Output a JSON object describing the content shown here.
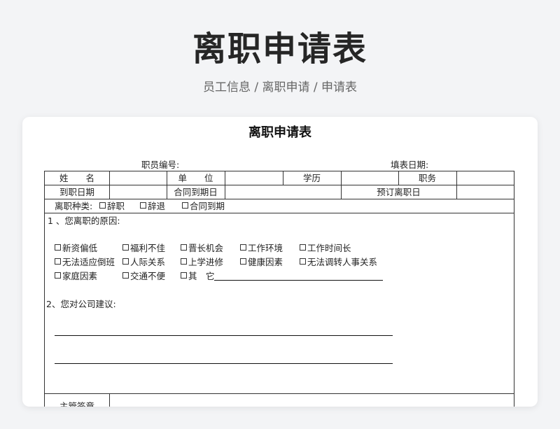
{
  "header": {
    "title": "离职申请表",
    "breadcrumb": "员工信息 / 离职申请 / 申请表"
  },
  "document": {
    "title": "离职申请表",
    "employee_no_label": "职员编号:",
    "fill_date_label": "填表日期:",
    "row1": {
      "name": "姓　　名",
      "unit": "单　　位",
      "education": "学历",
      "position": "职务"
    },
    "row2": {
      "join_date": "到职日期",
      "contract_end": "合同到期日",
      "planned_leave": "预订离职日"
    },
    "type": {
      "label": "离职种类:",
      "options": [
        "辞职",
        "辞退",
        "合同到期"
      ]
    },
    "reasons": {
      "heading": "1 、您离职的原因:",
      "options": [
        "新资偏低",
        "福利不佳",
        "晋长机会",
        "工作环境",
        "工作时间长",
        "无法适应倒班",
        "人际关系",
        "上学进修",
        "健康因素",
        "无法调转人事关系",
        "家庭因素",
        "交通不便",
        "其　它"
      ]
    },
    "suggestion": {
      "heading": "2、您对公司建议:"
    },
    "supervisor": {
      "label": "主管签章"
    }
  }
}
